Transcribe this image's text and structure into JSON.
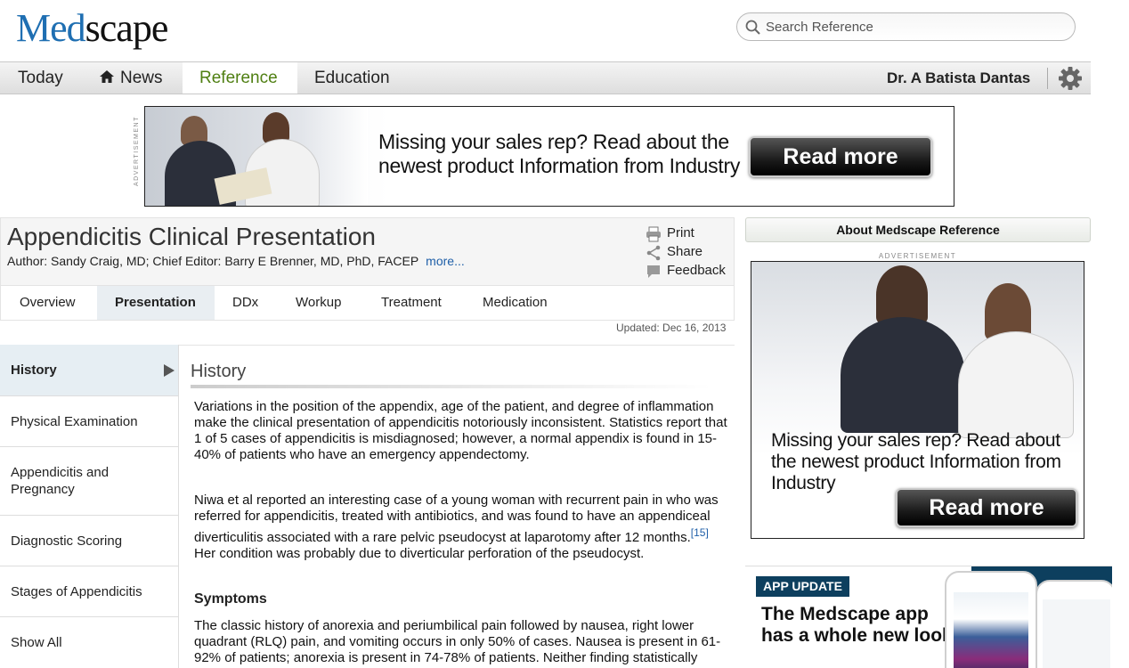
{
  "header": {
    "logo_part1": "Med",
    "logo_part2": "scape",
    "search_placeholder": "Search Reference"
  },
  "nav": {
    "items": [
      {
        "label": "Today"
      },
      {
        "label": "News",
        "icon": "home-icon"
      },
      {
        "label": "Reference",
        "active": true
      },
      {
        "label": "Education"
      }
    ],
    "user": "Dr. A Batista Dantas",
    "settings_icon": "gear-icon"
  },
  "top_ad": {
    "label": "ADVERTISEMENT",
    "text_line1": "Missing your sales rep? Read about the",
    "text_line2": "newest product Information from Industry",
    "button": "Read more"
  },
  "article": {
    "title": "Appendicitis Clinical Presentation",
    "meta": "Author: Sandy Craig, MD; Chief Editor: Barry E Brenner, MD, PhD, FACEP",
    "more": "more...",
    "tools": [
      "Print",
      "Share",
      "Feedback"
    ],
    "tabs": [
      {
        "label": "Overview"
      },
      {
        "label": "Presentation",
        "active": true
      },
      {
        "label": "DDx"
      },
      {
        "label": "Workup"
      },
      {
        "label": "Treatment"
      },
      {
        "label": "Medication"
      }
    ],
    "updated": "Updated: Dec 16, 2013"
  },
  "sidenav": {
    "items": [
      {
        "label": "History",
        "active": true
      },
      {
        "label": "Physical Examination"
      },
      {
        "label": "Appendicitis and Pregnancy"
      },
      {
        "label": "Diagnostic Scoring"
      },
      {
        "label": "Stages of Appendicitis"
      },
      {
        "label": "Show All"
      }
    ]
  },
  "content": {
    "section_title": "History",
    "para1": "Variations in the position of the appendix, age of the patient, and degree of inflammation make the clinical presentation of appendicitis notoriously inconsistent. Statistics report that 1 of 5 cases of appendicitis is misdiagnosed; however, a normal appendix is found in 15-40% of patients who have an emergency appendectomy.",
    "para2_a": "Niwa et al reported an interesting case of a young woman with recurrent pain in who was referred for appendicitis, treated with antibiotics, and was found to have an appendiceal diverticulitis associated with a rare pelvic pseudocyst at laparotomy after 12 months.",
    "para2_ref": "[15]",
    "para2_b": " Her condition was probably due to diverticular perforation of the pseudocyst.",
    "symptoms_heading": "Symptoms",
    "para3": "The classic history of anorexia and periumbilical pain followed by nausea, right lower quadrant (RLQ) pain, and vomiting occurs in only 50% of cases. Nausea is present in 61-92% of patients; anorexia is present in 74-78% of patients. Neither finding statistically differs from findings in patients with nonsurgical causes of abdominal pain."
  },
  "right": {
    "about": "About Medscape Reference",
    "adv_label": "ADVERTISEMENT",
    "side_ad": {
      "text_line1": "Missing your sales rep? Read about",
      "text_line2": "the newest product Information from",
      "text_line3": "Industry",
      "button": "Read more"
    },
    "app": {
      "tag": "APP UPDATE",
      "headline": "The Medscape app has a whole new look"
    }
  },
  "colors": {
    "brand_blue": "#1f6fb2",
    "nav_active_green": "#4f7f12",
    "link_blue": "#1f5fa8",
    "app_navy": "#0d3f5e"
  }
}
